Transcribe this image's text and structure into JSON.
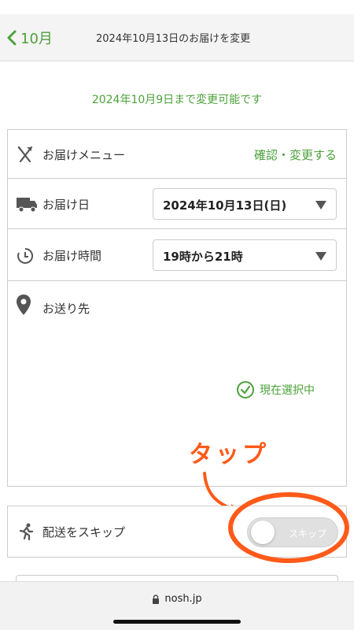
{
  "navbar": {
    "back_label": "10月",
    "title": "2024年10月13日のお届けを変更"
  },
  "deadline_notice": "2024年10月9日まで変更可能です",
  "delivery": {
    "menu": {
      "label": "お届けメニュー",
      "link": "確認・変更する"
    },
    "date": {
      "label": "お届け日",
      "selected": "2024年10月13日(日)"
    },
    "time": {
      "label": "お届け時間",
      "selected": "19時から21時"
    },
    "address": {
      "label": "お送り先",
      "status": "現在選択中"
    }
  },
  "annotation": {
    "text": "タップ"
  },
  "skip": {
    "label": "配送をスキップ",
    "toggle_label": "スキップ",
    "toggle_on": false
  },
  "browser": {
    "url": "nosh.jp"
  },
  "colors": {
    "accent_green": "#4ca13a",
    "annotation_orange": "#ff5a1a"
  }
}
